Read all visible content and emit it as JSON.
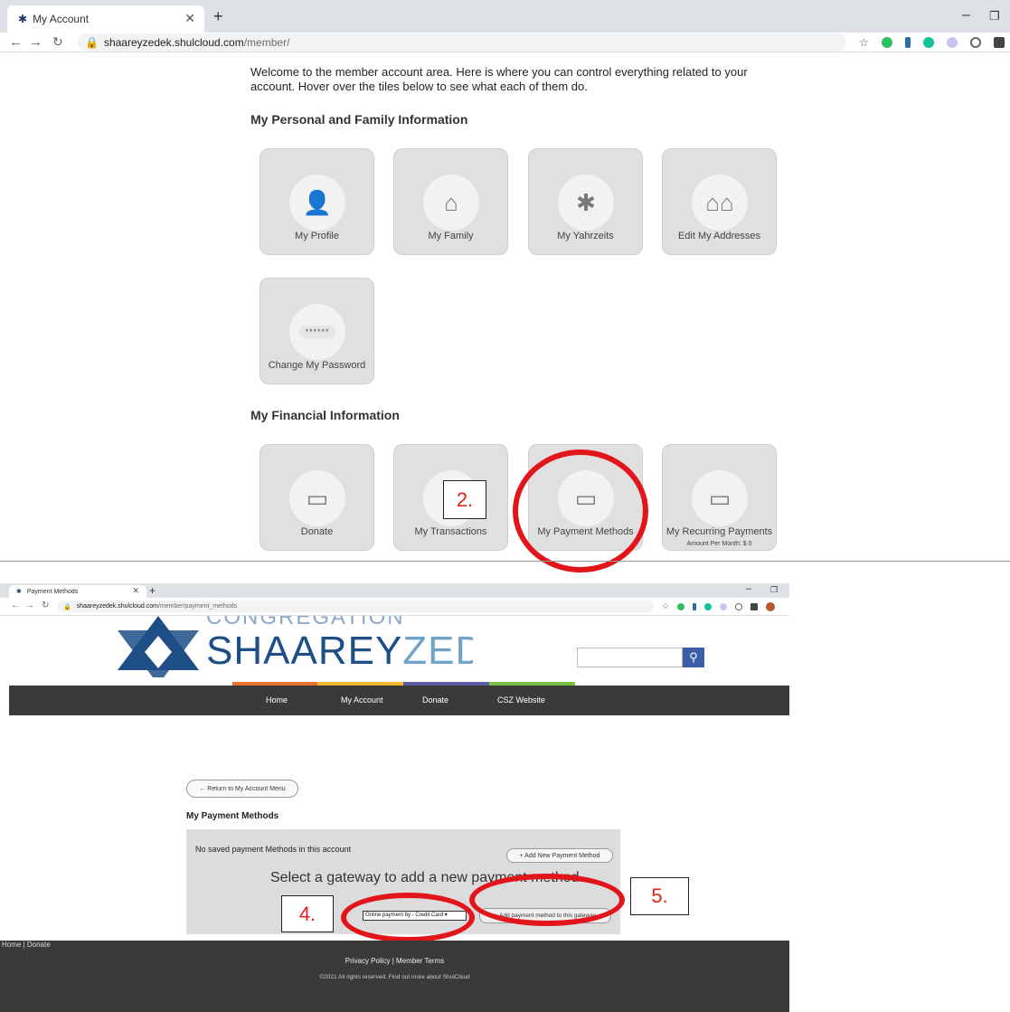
{
  "shot1": {
    "browser": {
      "tab_title": "My Account",
      "tab_favicon": "star-of-david-icon",
      "url_host": "shaareyzedek.shulcloud.com",
      "url_path": "/member/"
    },
    "welcome": "Welcome to the member account area. Here is where you can control everything related to your account. Hover over the tiles below to see what each of them do.",
    "personal_section": {
      "title": "My Personal and Family Information",
      "tiles": [
        "My Profile",
        "My Family",
        "My Yahrzeits",
        "Edit My Addresses",
        "Change My Password"
      ],
      "password_mask": "******"
    },
    "financial_section": {
      "title": "My Financial Information",
      "tiles": [
        "Donate",
        "My Transactions",
        "My Payment Methods",
        "My Recurring Payments"
      ],
      "recurring_sub": "Amount Per Month: $ 0"
    },
    "callouts": {
      "step2": "2."
    }
  },
  "shot2": {
    "browser": {
      "tab_title": "Payment Methods",
      "url_host": "shaareyzedek.shulcloud.com",
      "url_path": "/member/payment_methods"
    },
    "logo": {
      "line1": "CONGREGATION",
      "line2_a": "SHAAREY",
      "line2_b": "ZEDEK"
    },
    "nav": [
      "Home",
      "My Account",
      "Donate",
      "CSZ Website"
    ],
    "stripe_colors": [
      "#e8722c",
      "#f5b82e",
      "#5b5ea6",
      "#7bc143"
    ],
    "return_button": "← Return to My Account Menu",
    "page_title": "My Payment Methods",
    "no_saved": "No saved payment Methods in this account",
    "add_new": "+ Add New Payment Method",
    "select_gateway": "Select a gateway to add a new payment method.",
    "gateway_option": "Online payment by - Credit Card",
    "add_to_gateway": "+ Add payment method to this gateway",
    "callouts": {
      "step4": "4.",
      "step5": "5."
    },
    "footer": {
      "top_links": "Home | Donate",
      "links": "Privacy Policy  |  Member Terms",
      "copyright": "©2021 All rights reserved. Find out more about ShulCloud"
    }
  },
  "colors": {
    "annotation_red": "#e2151b",
    "nav_dark": "#3a3a3a",
    "search_blue": "#3b5ea8"
  }
}
